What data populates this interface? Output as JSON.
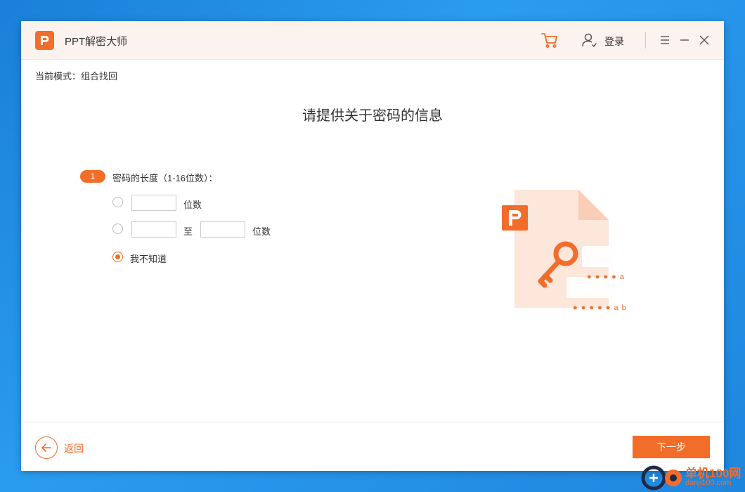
{
  "app": {
    "title": "PPT解密大师",
    "login_label": "登录"
  },
  "mode_label": "当前模式：组合找回",
  "heading": "请提供关于密码的信息",
  "step": {
    "number": "1",
    "label": "密码的长度（1-16位数）：",
    "options": [
      {
        "value": "",
        "suffix": "位数",
        "selected": false
      },
      {
        "from": "",
        "to_word": "至",
        "to": "",
        "suffix": "位数",
        "selected": false
      },
      {
        "label": "我不知道",
        "selected": true
      }
    ]
  },
  "illustration": {
    "field1": "● ● ● ● a",
    "field2": "● ● ● ● ● a b"
  },
  "footer": {
    "back_label": "返回",
    "next_label": "下一步"
  },
  "watermark": {
    "brand": "单机100网",
    "url": "danji100.com"
  },
  "colors": {
    "accent": "#f26c2a",
    "titlebar_bg": "#fdf3ee"
  },
  "icons": [
    "logo-icon",
    "cart-icon",
    "user-icon",
    "menu-icon",
    "minimize-icon",
    "close-icon",
    "back-arrow-icon",
    "key-icon"
  ]
}
